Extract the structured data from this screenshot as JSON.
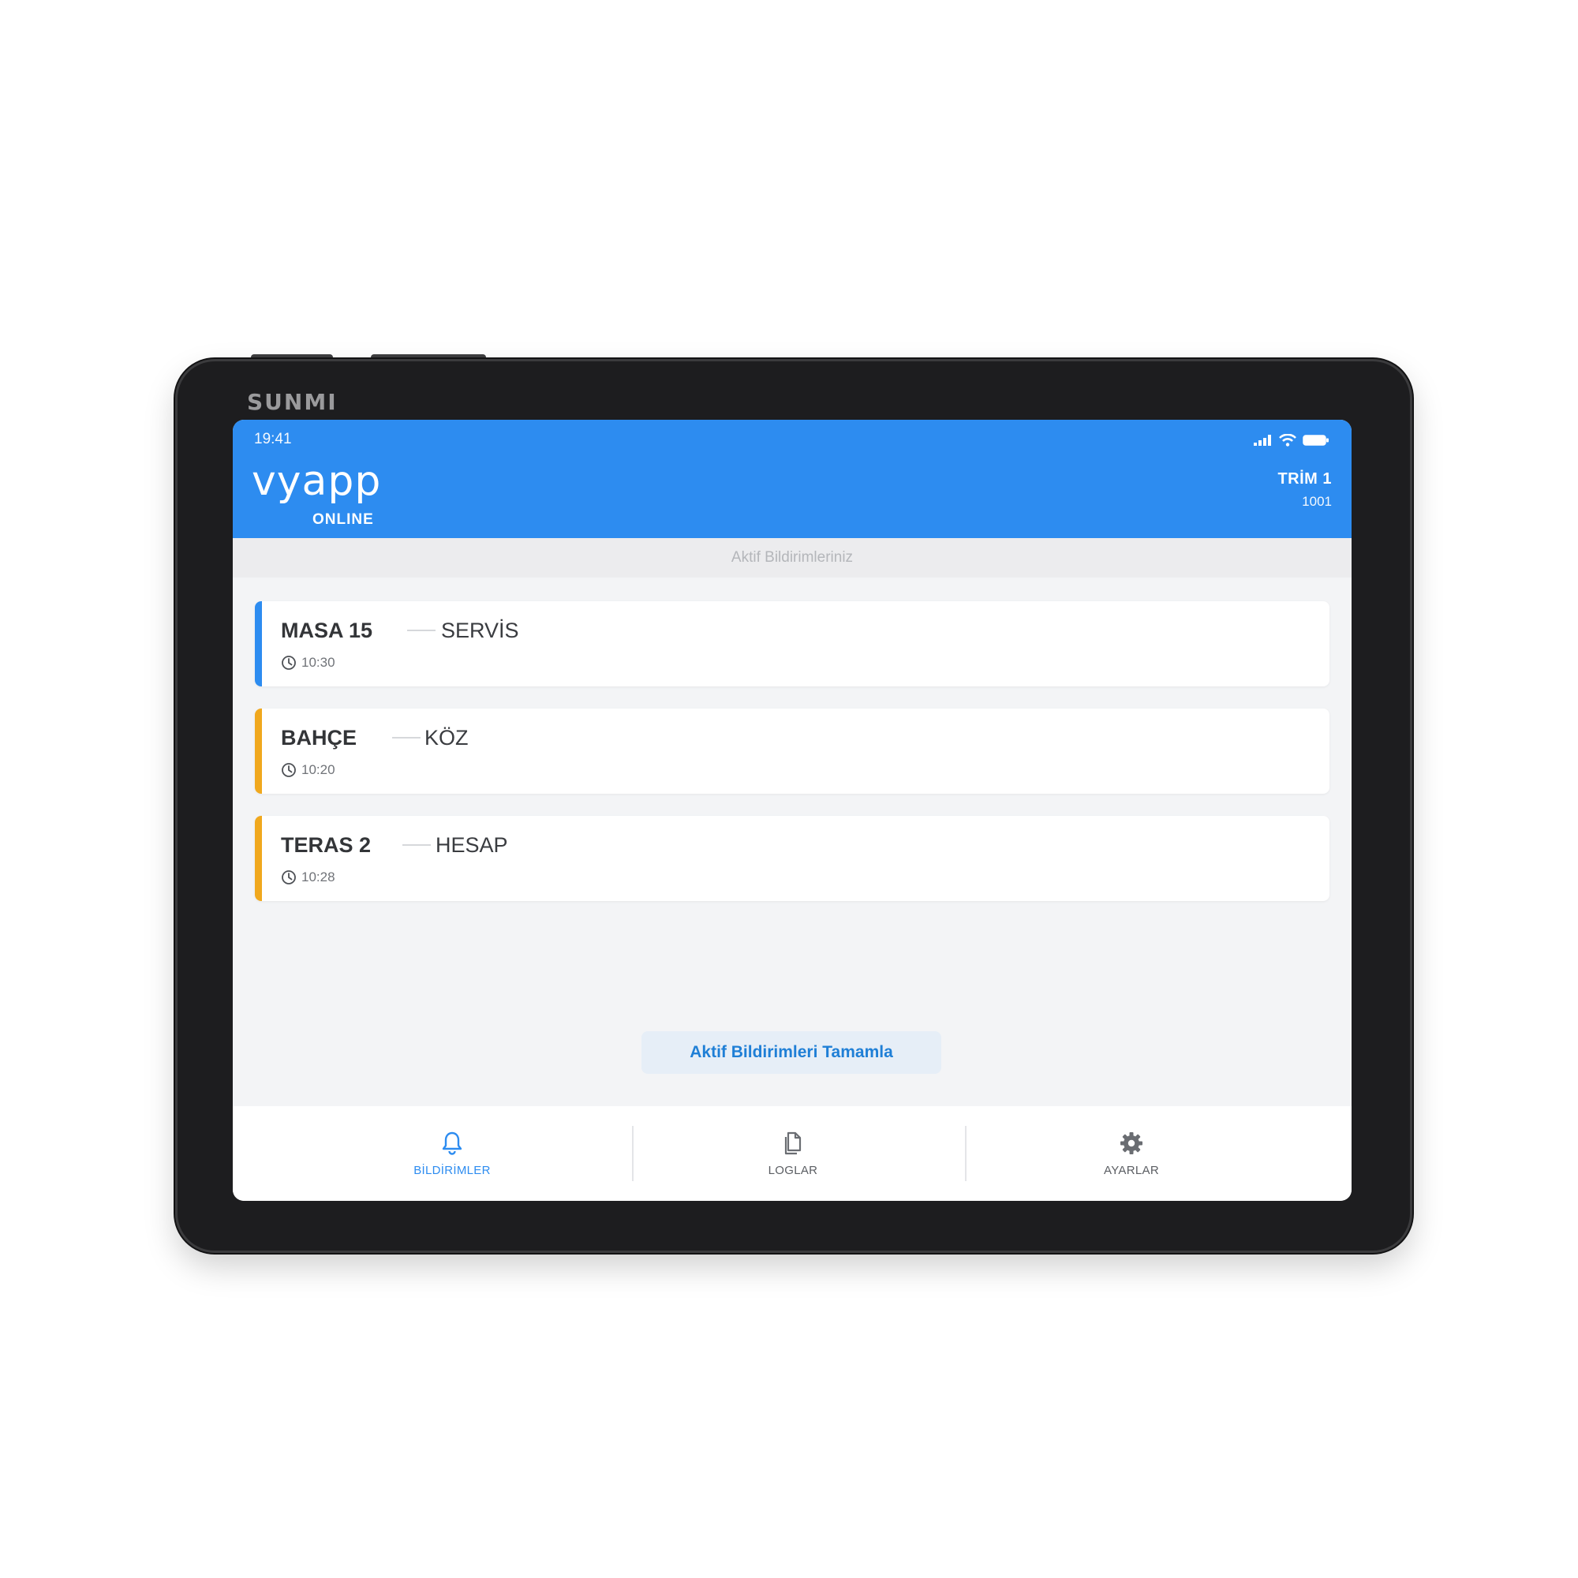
{
  "device": {
    "brand": "SUNMI"
  },
  "status_bar": {
    "time": "19:41"
  },
  "header": {
    "logo": "vyapp",
    "connection_status": "ONLINE",
    "device_name": "TRİM 1",
    "device_id": "1001"
  },
  "section_title": "Aktif Bildirimleriniz",
  "notifications": [
    {
      "table": "MASA 15",
      "request": "SERVİS",
      "time": "10:30",
      "accent_color": "#2d8cf0"
    },
    {
      "table": "BAHÇE",
      "request": "KÖZ",
      "time": "10:20",
      "accent_color": "#f0a81e"
    },
    {
      "table": "TERAS 2",
      "request": "HESAP",
      "time": "10:28",
      "accent_color": "#f0a81e"
    }
  ],
  "complete_button": "Aktif Bildirimleri Tamamla",
  "tabs": [
    {
      "label": "BİLDİRİMLER",
      "icon": "bell-icon",
      "active": true
    },
    {
      "label": "LOGLAR",
      "icon": "document-icon",
      "active": false
    },
    {
      "label": "AYARLAR",
      "icon": "gear-icon",
      "active": false
    }
  ],
  "colors": {
    "primary": "#2d8cf0",
    "warning": "#f0a81e",
    "background": "#f3f4f6"
  }
}
